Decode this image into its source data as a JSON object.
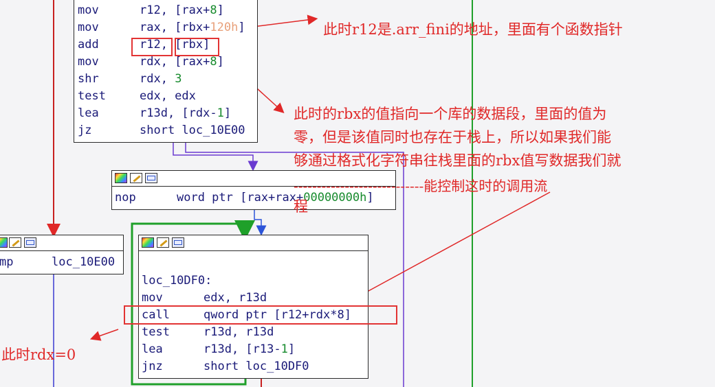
{
  "block_top": {
    "lines": [
      {
        "op": "mov",
        "a": "r12, [rax+",
        "num": "8",
        "b": "]"
      },
      {
        "op": "mov",
        "a": "rax, [rbx+",
        "num": "120h",
        "b": "]"
      },
      {
        "op": "add",
        "a": "r12, [rbx]",
        "num": "",
        "b": ""
      },
      {
        "op": "mov",
        "a": "rdx, [rax+",
        "num": "8",
        "b": "]"
      },
      {
        "op": "shr",
        "a": "rdx, ",
        "num": "3",
        "b": ""
      },
      {
        "op": "test",
        "a": "edx, edx",
        "num": "",
        "b": ""
      },
      {
        "op": "lea",
        "a": "r13d, [rdx-",
        "num": "1",
        "b": "]"
      },
      {
        "op": "jz",
        "a": "short loc_10E00",
        "num": "",
        "b": ""
      }
    ]
  },
  "block_nop": {
    "op": "nop",
    "a": "word ptr [rax+rax+",
    "num": "00000000h",
    "b": "]"
  },
  "block_left": {
    "op": "mp",
    "a": "loc_10E00"
  },
  "block_loop": {
    "label": "loc_10DF0:",
    "lines": [
      {
        "op": "mov",
        "a": "edx, r13d",
        "num": "",
        "b": ""
      },
      {
        "op": "call",
        "a": "qword ptr [r12+rdx*8]",
        "num": "",
        "b": ""
      },
      {
        "op": "test",
        "a": "r13d, r13d",
        "num": "",
        "b": ""
      },
      {
        "op": "lea",
        "a": "r13d, [r13-",
        "num": "1",
        "b": "]"
      },
      {
        "op": "jnz",
        "a": "short loc_10DF0",
        "num": "",
        "b": ""
      }
    ]
  },
  "annotations": {
    "r12_note": "此时r12是.arr_fini的地址，里面有个函数指针",
    "rbx_note_1": "此时的rbx的值指向一个库的数据段，里面的值为",
    "rbx_note_2": "零，但是该值同时也存在于栈上，所以如果我们能",
    "rbx_note_3": "够通过格式化字符串往栈里面的rbx值写数据我们就",
    "rbx_note_4": "----------------------------能控制这时的调用流",
    "rbx_note_5": "程",
    "rdx_note": "此时rdx=0"
  },
  "colors": {
    "annotation": "#e02828",
    "edge_blue": "#3a3ad0",
    "edge_green": "#1fa02a",
    "edge_red": "#c82020",
    "edge_purple": "#7d52c8"
  }
}
